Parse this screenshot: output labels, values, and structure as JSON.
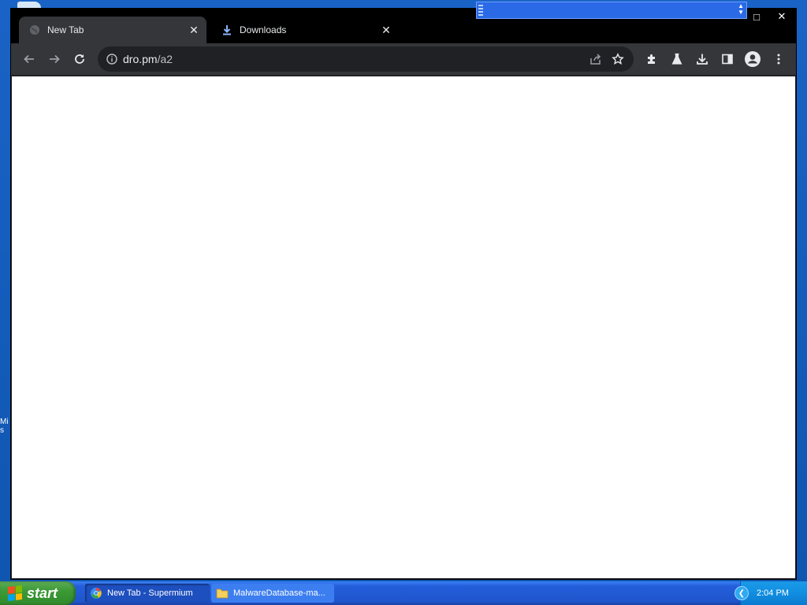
{
  "browser": {
    "tabs": [
      {
        "label": "New Tab",
        "icon": "globe-icon",
        "active": true
      },
      {
        "label": "Downloads",
        "icon": "download-icon",
        "active": false
      }
    ],
    "window_controls": {
      "restore": "□",
      "close": "✕"
    },
    "address_bar": {
      "host": "dro.pm",
      "path": "/a2"
    },
    "toolbar_icons": [
      "back-icon",
      "forward-icon",
      "reload-icon",
      "info-icon",
      "share-icon",
      "star-icon",
      "extensions-icon",
      "labs-icon",
      "download-icon",
      "sidepanel-icon",
      "profile-icon",
      "menu-icon"
    ],
    "tab_close": "✕",
    "colors": {
      "tabstrip": "#000000",
      "toolbar": "#35363a",
      "omnibox": "#202124",
      "accent_download": "#8ab4f8"
    }
  },
  "taskbar": {
    "start_label": "start",
    "tasks": [
      {
        "label": "New Tab - Supermium",
        "icon": "browser-icon"
      },
      {
        "label": "MalwareDatabase-ma...",
        "icon": "folder-icon"
      }
    ],
    "clock": "2:04 PM"
  },
  "desktop": {
    "icon_label_fragment": "Mi\ns"
  }
}
